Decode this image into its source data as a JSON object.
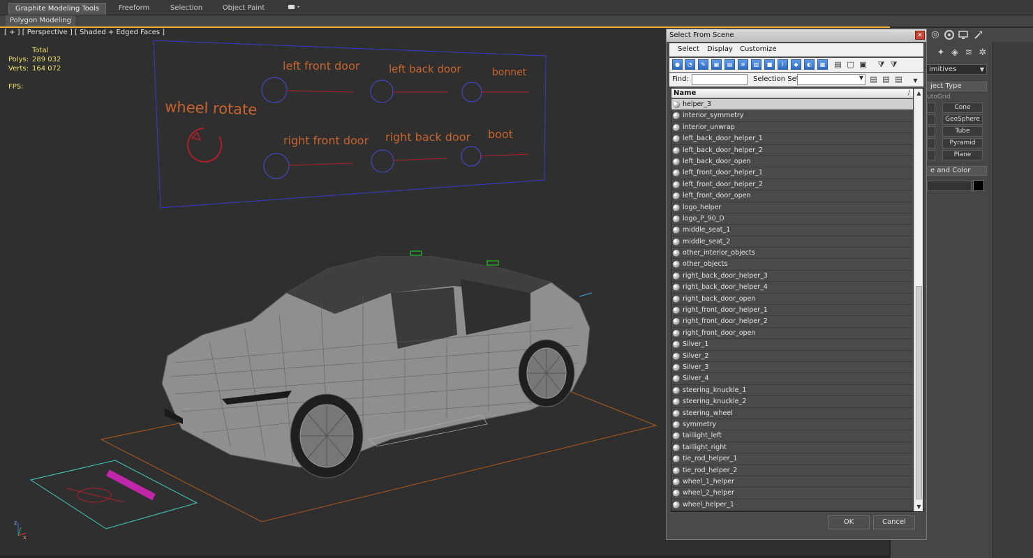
{
  "ribbon": {
    "tabs": [
      "Graphite Modeling Tools",
      "Freeform",
      "Selection",
      "Object Paint"
    ],
    "sub_label": "Polygon Modeling"
  },
  "viewport": {
    "label": "[ + ] [ Perspective ] [ Shaded + Edged Faces ]",
    "stats": {
      "total_label": "Total",
      "polys_label": "Polys:",
      "polys_value": "289 032",
      "verts_label": "Verts:",
      "verts_value": "164 072",
      "fps_label": "FPS:"
    },
    "control_panel_labels": {
      "wheel_rotate": "wheel rotate",
      "left_front_door": "left front door",
      "left_back_door": "left back door",
      "bonnet": "bonnet",
      "right_front_door": "right front door",
      "right_back_door": "right back door",
      "boot": "boot"
    }
  },
  "command_panel": {
    "dropdown_value": "imitives",
    "object_type_header": "ject Type",
    "autogrid_label": "utoGrid",
    "buttons": [
      "Cone",
      "GeoSphere",
      "Tube",
      "Pyramid",
      "Plane"
    ],
    "name_color_header": "e and Color"
  },
  "dialog": {
    "title": "Select From Scene",
    "close_glyph": "✕",
    "menus": [
      "Select",
      "Display",
      "Customize"
    ],
    "find_label": "Find:",
    "selection_set_label": "Selection Set:",
    "column_header": "Name",
    "sort_indicator": "/",
    "ok_label": "OK",
    "cancel_label": "Cancel",
    "items": [
      {
        "name": "helper_3",
        "selected": true
      },
      {
        "name": "interior_symmetry"
      },
      {
        "name": "interior_unwrap"
      },
      {
        "name": "left_back_door_helper_1"
      },
      {
        "name": "left_back_door_helper_2"
      },
      {
        "name": "left_back_door_open"
      },
      {
        "name": "left_front_door_helper_1"
      },
      {
        "name": "left_front_door_helper_2"
      },
      {
        "name": "left_front_door_open"
      },
      {
        "name": "logo_helper"
      },
      {
        "name": "logo_P_90_D"
      },
      {
        "name": "middle_seat_1"
      },
      {
        "name": "middle_seat_2"
      },
      {
        "name": "other_interior_objects"
      },
      {
        "name": "other_objects"
      },
      {
        "name": "right_back_door_helper_3"
      },
      {
        "name": "right_back_door_helper_4"
      },
      {
        "name": "right_back_door_open"
      },
      {
        "name": "right_front_door_helper_1"
      },
      {
        "name": "right_front_door_helper_2"
      },
      {
        "name": "right_front_door_open"
      },
      {
        "name": "Silver_1"
      },
      {
        "name": "Silver_2"
      },
      {
        "name": "Silver_3"
      },
      {
        "name": "Silver_4"
      },
      {
        "name": "steering_knuckle_1"
      },
      {
        "name": "steering_knuckle_2"
      },
      {
        "name": "steering_wheel"
      },
      {
        "name": "symmetry"
      },
      {
        "name": "taillight_left"
      },
      {
        "name": "taillight_right"
      },
      {
        "name": "tie_rod_helper_1"
      },
      {
        "name": "tie_rod_helper_2"
      },
      {
        "name": "wheel_1_helper"
      },
      {
        "name": "wheel_2_helper"
      },
      {
        "name": "wheel_helper_1"
      }
    ]
  },
  "colors": {
    "accent_orange": "#f2b53a",
    "stats_yellow": "#f0e36a",
    "label_orange": "#c8642e",
    "helper_blue": "#4a4ae0",
    "selection_blue": "#2d6cc4"
  }
}
